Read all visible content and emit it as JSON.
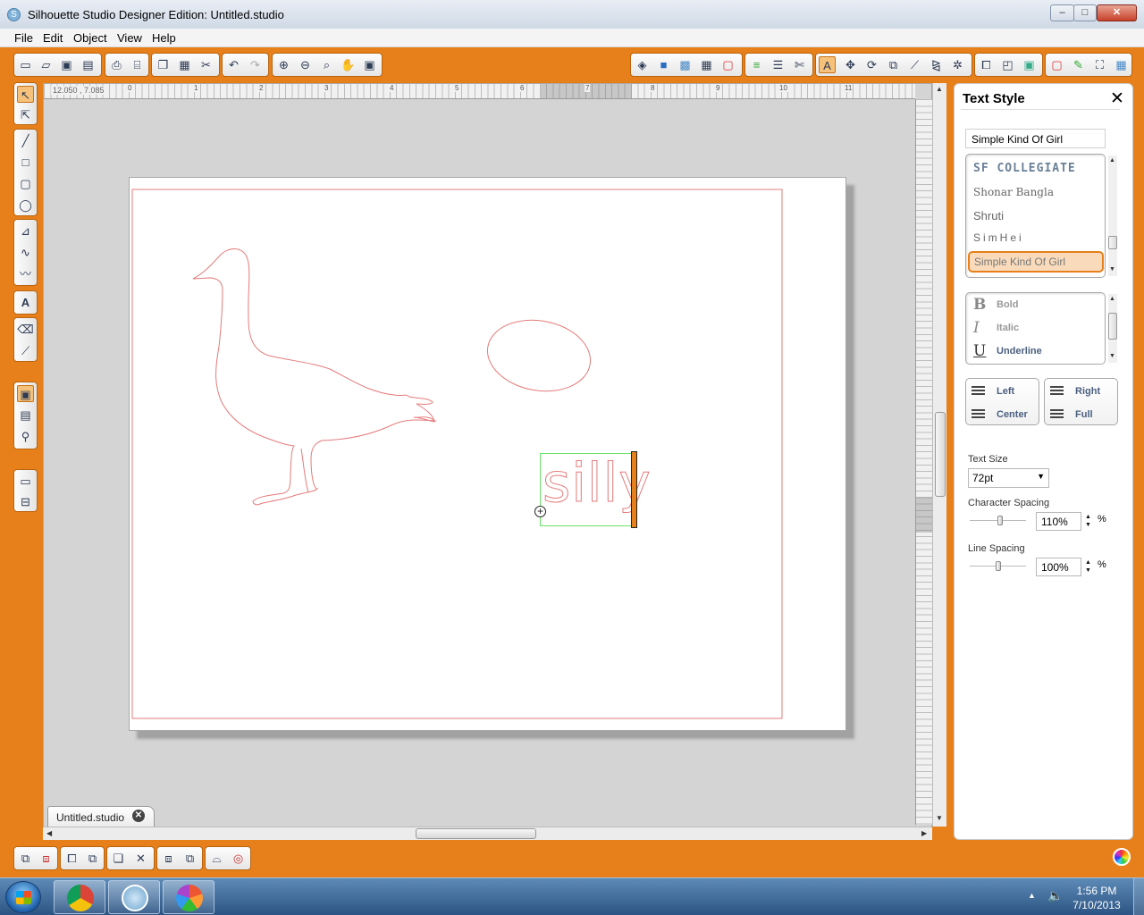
{
  "window": {
    "title": "Silhouette Studio Designer Edition: Untitled.studio",
    "minimize": "–",
    "maximize": "□",
    "close": "✕"
  },
  "menu": [
    "File",
    "Edit",
    "Object",
    "View",
    "Help"
  ],
  "canvas": {
    "ruler_coords": "12.050 , 7.085",
    "ruler_ticks": [
      "0",
      "1",
      "2",
      "3",
      "4",
      "5",
      "6",
      "7",
      "8",
      "9",
      "10",
      "11"
    ],
    "text_object": "silly",
    "doc_tab": "Untitled.studio",
    "doc_tab_close": "✕"
  },
  "panel": {
    "title": "Text Style",
    "close": "✕",
    "font_search_value": "Simple Kind Of Girl",
    "fonts": [
      "SF COLLEGIATE",
      "Shonar Bangla",
      "Shruti",
      "SimHei",
      "Simple Kind Of Girl"
    ],
    "selected_font": "Simple Kind Of Girl",
    "styles": {
      "bold_icon": "B",
      "bold": "Bold",
      "italic_icon": "I",
      "italic": "Italic",
      "underline_icon": "U",
      "underline": "Underline"
    },
    "align": {
      "left": "Left",
      "center": "Center",
      "right": "Right",
      "full": "Full"
    },
    "text_size_label": "Text Size",
    "text_size_value": "72pt",
    "char_spacing_label": "Character Spacing",
    "char_spacing_value": "110%",
    "char_spacing_fraction": 0.55,
    "line_spacing_label": "Line Spacing",
    "line_spacing_value": "100%",
    "line_spacing_fraction": 0.5,
    "unit": "%"
  },
  "taskbar": {
    "time": "1:56 PM",
    "date": "7/10/2013",
    "apps": [
      "chrome-icon",
      "silhouette-icon",
      "picasa-icon"
    ]
  },
  "colors": {
    "accent": "#e7801a",
    "cut_line": "#e57b7b",
    "selection": "#6ae36a"
  }
}
